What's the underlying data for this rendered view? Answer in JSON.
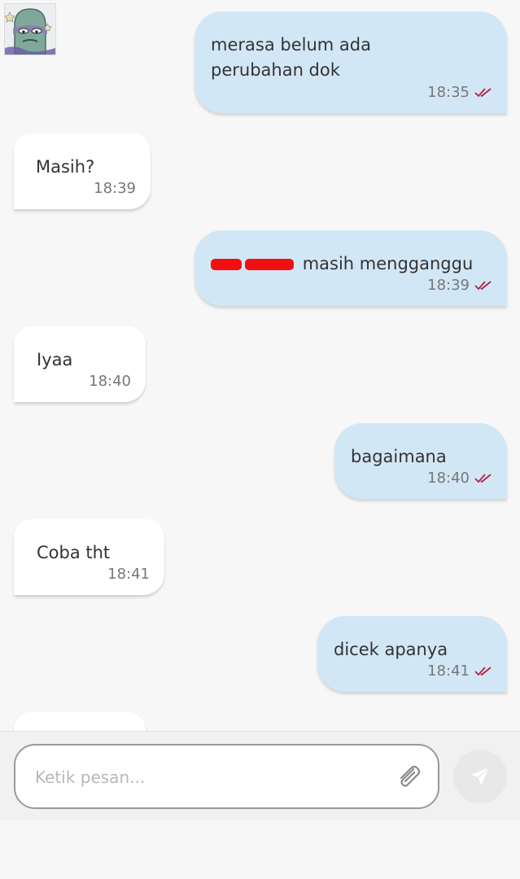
{
  "messages": [
    {
      "direction": "out",
      "text": "merasa belum ada perubahan dok",
      "time": "18:35",
      "status": "read"
    },
    {
      "direction": "in",
      "text": "Masih?",
      "time": "18:39"
    },
    {
      "direction": "out",
      "text": "masih mengganggu",
      "time": "18:39",
      "status": "read",
      "redacted_prefix": true
    },
    {
      "direction": "in",
      "text": "Iyaa",
      "time": "18:40"
    },
    {
      "direction": "out",
      "text": "bagaimana",
      "time": "18:40",
      "status": "read"
    },
    {
      "direction": "in",
      "text": "Coba tht",
      "time": "18:41"
    },
    {
      "direction": "out",
      "text": "dicek apanya",
      "time": "18:41",
      "status": "read"
    }
  ],
  "composer": {
    "placeholder": "Ketik pesan...",
    "attach_icon": "paperclip-icon",
    "send_icon": "send-icon"
  },
  "colors": {
    "outgoing_bubble": "#d2e7f6",
    "incoming_bubble": "#ffffff",
    "read_check": "#b5213f",
    "background": "#f7f7f7"
  }
}
